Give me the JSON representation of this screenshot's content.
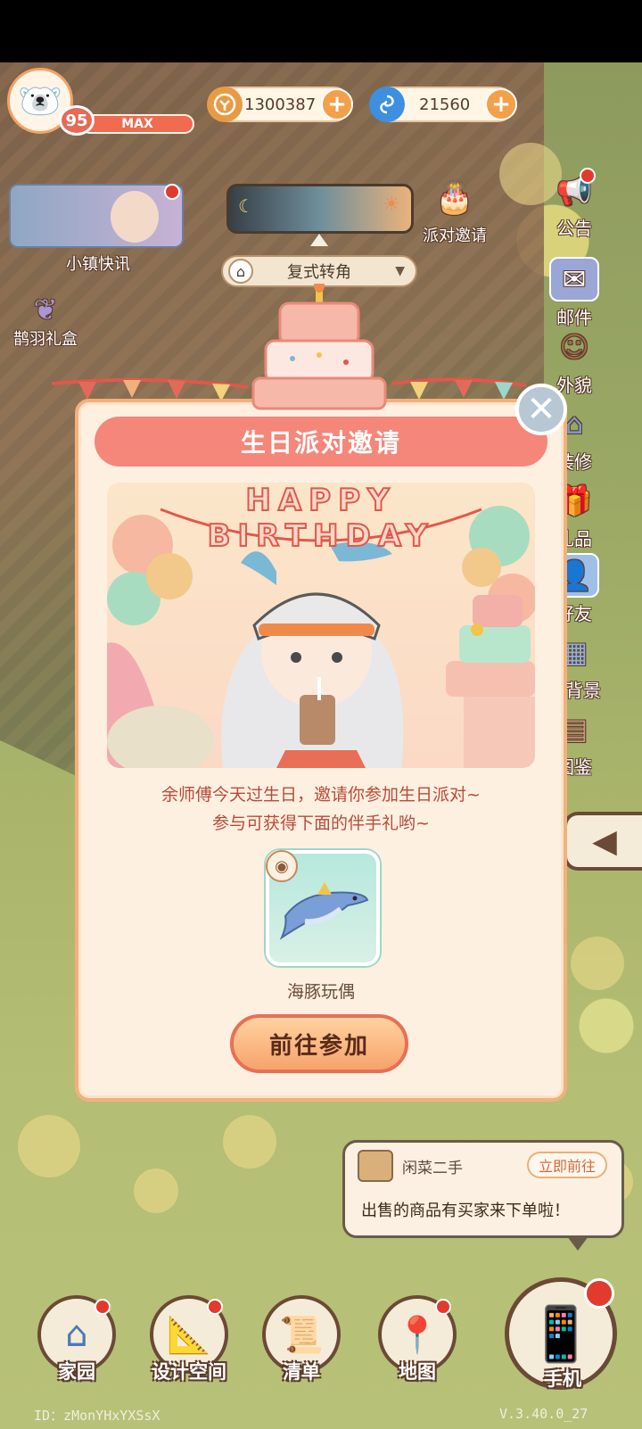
{
  "player": {
    "level": "95",
    "level_status": "MAX"
  },
  "currency": {
    "coins": "1300387",
    "gems": "21560"
  },
  "left_panel": {
    "news_label": "小镇快讯",
    "gift_label": "鹊羽礼盒"
  },
  "center_top": {
    "time_mode_label": "复式转角",
    "party_invite_label": "派对邀请"
  },
  "right_menu": {
    "items": [
      {
        "label": "公告",
        "icon": "megaphone-icon"
      },
      {
        "label": "邮件",
        "icon": "mail-icon"
      },
      {
        "label": "外貌",
        "icon": "character-icon"
      },
      {
        "label": "装修",
        "icon": "house-tools-icon"
      },
      {
        "label": "礼品",
        "icon": "gift-icon"
      },
      {
        "label": "好友",
        "icon": "friends-icon"
      },
      {
        "label": "换背景",
        "icon": "background-icon"
      },
      {
        "label": "图鉴",
        "icon": "catalog-icon"
      }
    ]
  },
  "dialog": {
    "title": "生日派对邀请",
    "banner_text": "HAPPY BIRTHDAY",
    "invite_line1": "余师傅今天过生日，邀请你参加生日派对~",
    "invite_line2": "参与可获得下面的伴手礼哟~",
    "reward_name": "海豚玩偶",
    "go_button": "前往参加"
  },
  "notification": {
    "app_name": "闲菜二手",
    "go_label": "立即前往",
    "message": "出售的商品有买家来下单啦！"
  },
  "bottom_nav": {
    "home": "家园",
    "design": "设计空间",
    "list": "清单",
    "map": "地图",
    "phone": "手机"
  },
  "footer": {
    "id_text": "ID：zMonYHxYXSsX",
    "version": "V.3.40.0_27"
  },
  "colors": {
    "dialog_title_bg": "#f4867a",
    "dialog_border": "#f2b07c",
    "badge_red": "#e23b2e",
    "go_button_border": "#e86f55"
  }
}
